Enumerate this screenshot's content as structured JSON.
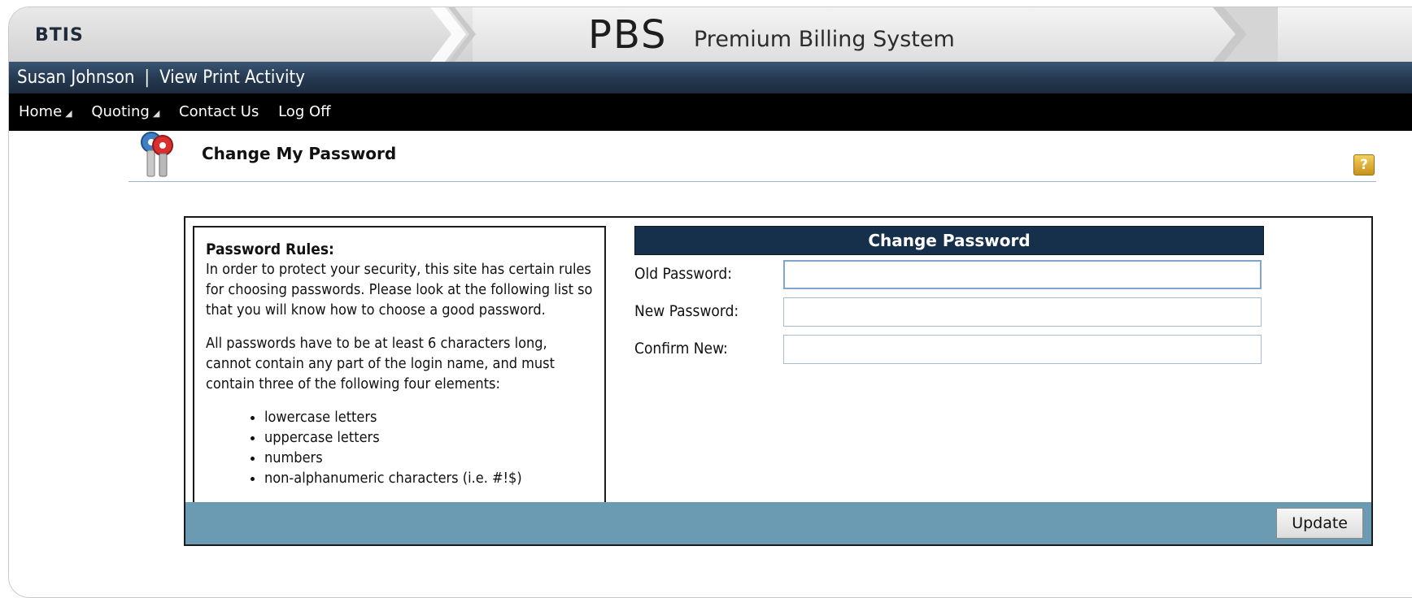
{
  "banner": {
    "brand": "BTIS",
    "logo": "PBS",
    "system_name": "Premium Billing System"
  },
  "userbar": {
    "user_name": "Susan Johnson",
    "separator": "|",
    "print_activity": "View Print Activity"
  },
  "nav": {
    "home": "Home",
    "quoting": "Quoting",
    "contact": "Contact Us",
    "logoff": "Log Off"
  },
  "page": {
    "title": "Change My Password",
    "help_glyph": "?"
  },
  "rules": {
    "heading": "Password Rules:",
    "intro": "In order to protect your security, this site has certain rules for choosing passwords. Please look at the following list so that you will know how to choose a good password.",
    "requirements": "All passwords have to be at least 6 characters long, cannot contain any part of the login name, and must contain three of the following four elements:",
    "items": [
      "lowercase letters",
      "uppercase letters",
      "numbers",
      "non-alphanumeric characters (i.e. #!$)"
    ]
  },
  "form": {
    "title": "Change Password",
    "old_label": "Old Password:",
    "new_label": "New Password:",
    "confirm_label": "Confirm New:",
    "old_value": "",
    "new_value": "",
    "confirm_value": "",
    "update_label": "Update"
  },
  "colors": {
    "title_bar": "#16304c",
    "footer_bar": "#6b9bb2",
    "user_bar": "#24384f"
  },
  "icons": [
    "keys-icon",
    "help-icon",
    "caret-down-icon"
  ]
}
